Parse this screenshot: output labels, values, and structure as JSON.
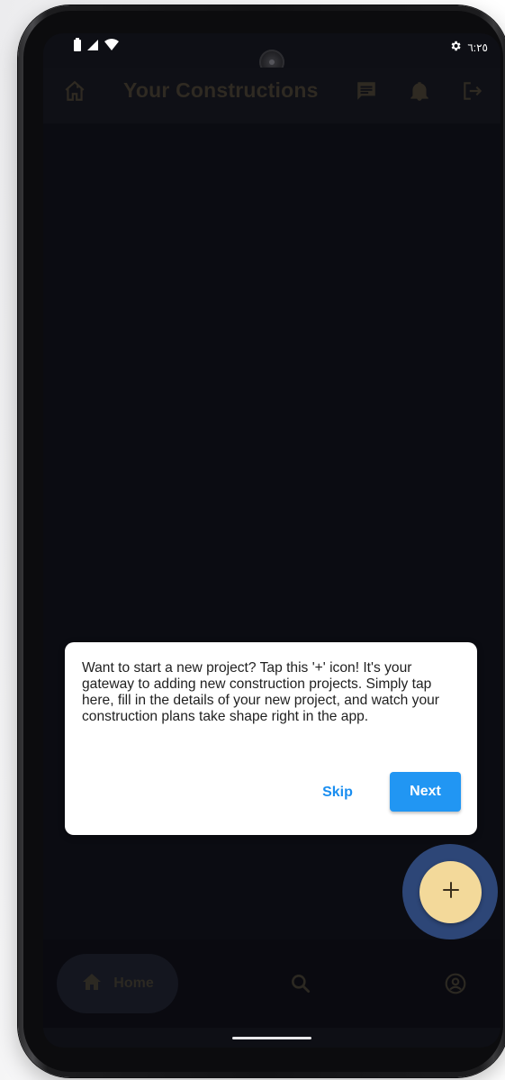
{
  "status_bar": {
    "time": "٦:٢٥",
    "icons": [
      "battery-icon",
      "signal-icon",
      "wifi-icon",
      "settings-icon"
    ]
  },
  "app_bar": {
    "title": "Your Constructions",
    "icons": [
      "home-outline-icon",
      "chat-icon",
      "notification-bell-icon",
      "logout-icon"
    ]
  },
  "tooltip": {
    "text": "Want to start a new project? Tap this '+' icon! It's your gateway to adding new construction projects. Simply tap here, fill in the details of your new project, and watch your construction plans take shape right in the app.",
    "skip_label": "Skip",
    "next_label": "Next"
  },
  "fab": {
    "icon": "plus-icon"
  },
  "bottom_nav": {
    "items": [
      {
        "label": "Home",
        "icon": "home-icon",
        "active": true
      },
      {
        "label": "",
        "icon": "search-icon",
        "active": false
      },
      {
        "label": "",
        "icon": "profile-icon",
        "active": false
      }
    ]
  },
  "colors": {
    "screen_bg": "#0b0c12",
    "dimmed_text": "#2f2a22",
    "accent_blue": "#2196f3",
    "fab_fill": "#f3d99a",
    "fab_halo": "#2d4677"
  }
}
